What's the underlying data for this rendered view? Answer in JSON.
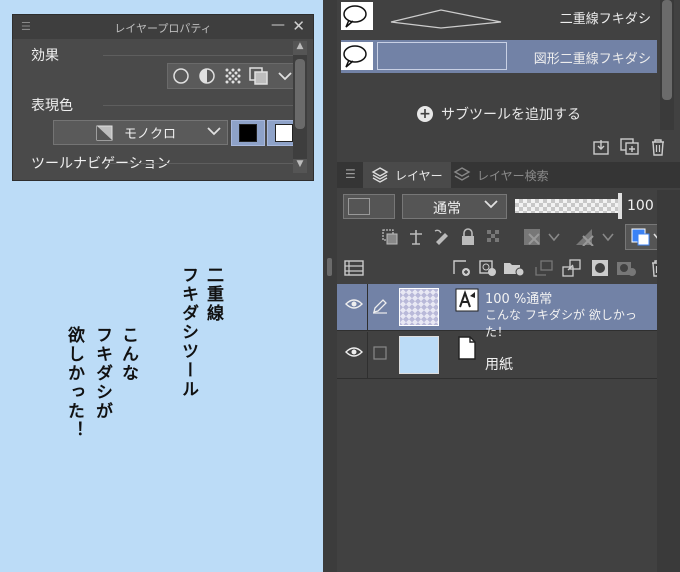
{
  "canvas": {
    "lines": [
      "二重線",
      "フキダシツール",
      "こんな",
      "フキダシが",
      "欲しかった！"
    ]
  },
  "layer_property": {
    "title": "レイヤープロパティ",
    "effect_label": "効果",
    "expression_label": "表現色",
    "expression_value": "モノクロ",
    "nav_label": "ツールナビゲーション",
    "swatches": [
      "#000000",
      "#ffffff"
    ]
  },
  "subtool": {
    "items": [
      {
        "name": "二重線フキダシ",
        "selected": false
      },
      {
        "name": "図形二重線フキダシ",
        "selected": true
      }
    ],
    "add_label": "サブツールを追加する"
  },
  "layer_panel": {
    "tabs": [
      {
        "label": "レイヤー",
        "active": true
      },
      {
        "label": "レイヤー検索",
        "active": false
      }
    ],
    "blend_mode": "通常",
    "opacity": "100",
    "layers": [
      {
        "line1": "100 %通常",
        "line2": "こんな フキダシが 欲しかった！",
        "selected": true
      },
      {
        "name": "用紙",
        "selected": false
      }
    ]
  },
  "colors": {
    "canvas_bg": "#bcdcf7",
    "panel_bg": "#414141",
    "selection": "#7282a6",
    "accent_blue": "#3b82f6"
  }
}
